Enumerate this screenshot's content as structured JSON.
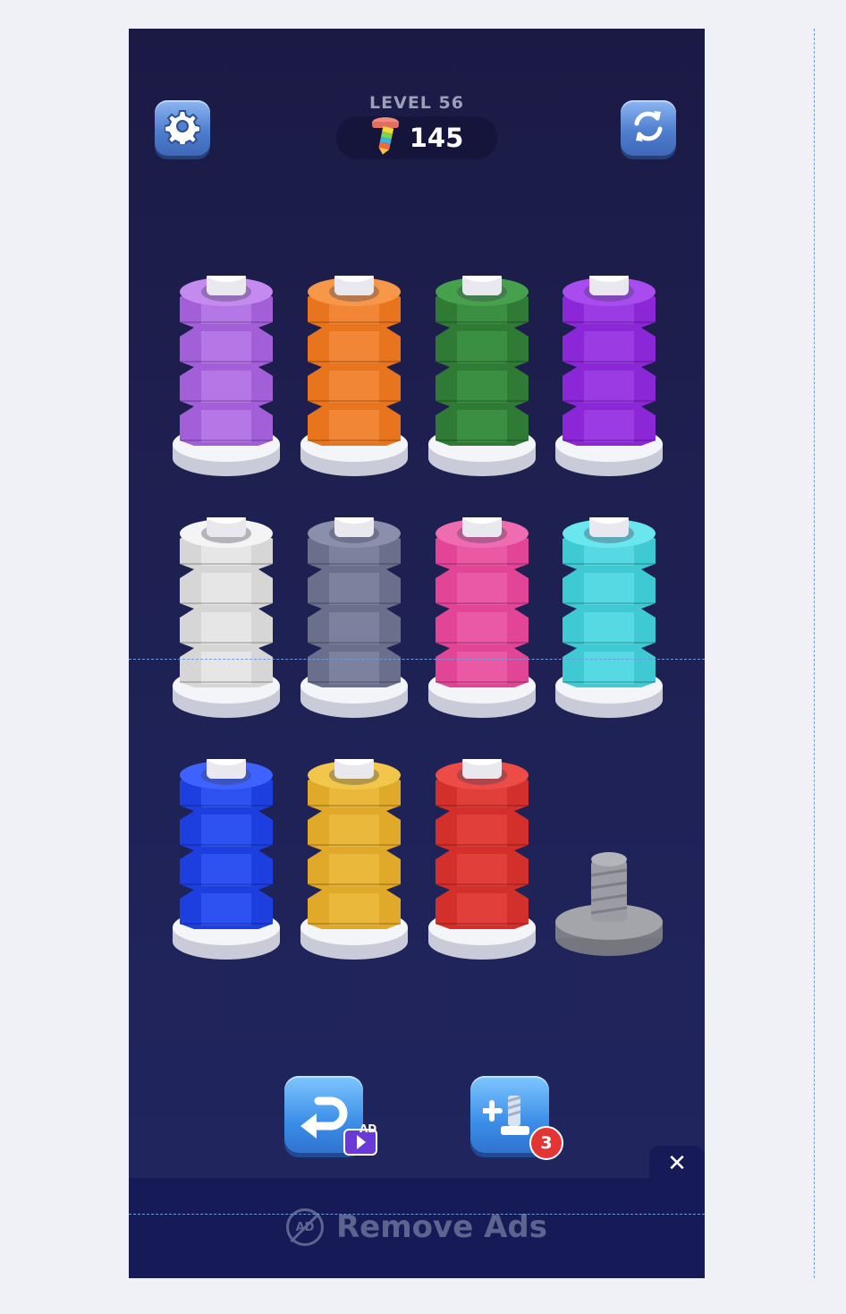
{
  "header": {
    "level_label": "LEVEL 56",
    "coin_count": "145"
  },
  "buttons": {
    "settings_icon": "gear-icon",
    "restart_icon": "refresh-icon",
    "undo_icon": "undo-arrow-icon",
    "undo_ad_label": "AD",
    "add_bolt_icon": "add-bolt-icon",
    "add_bolt_count": "3",
    "close_label": "✕"
  },
  "board": {
    "poles": [
      {
        "color": "#a25fd8",
        "light": "#c48af0",
        "nuts": 4
      },
      {
        "color": "#e8741e",
        "light": "#f7974a",
        "nuts": 4
      },
      {
        "color": "#2f7a35",
        "light": "#46a04c",
        "nuts": 4
      },
      {
        "color": "#8b27d6",
        "light": "#a84cf0",
        "nuts": 4
      },
      {
        "color": "#d6d6d6",
        "light": "#f4f4f4",
        "nuts": 4
      },
      {
        "color": "#6a6f8c",
        "light": "#8a8fab",
        "nuts": 4
      },
      {
        "color": "#e24596",
        "light": "#f06cb0",
        "nuts": 4
      },
      {
        "color": "#3fcad3",
        "light": "#6ae6ee",
        "nuts": 4
      },
      {
        "color": "#1d3fe0",
        "light": "#3d62ff",
        "nuts": 4
      },
      {
        "color": "#e0a92a",
        "light": "#f2c64a",
        "nuts": 4
      },
      {
        "color": "#d3302b",
        "light": "#ec4c45",
        "nuts": 4
      },
      {
        "color": "#8f8f96",
        "light": "#a9a9b0",
        "nuts": 0
      }
    ]
  },
  "ad_bar": {
    "remove_ads_label": "Remove Ads",
    "no_ad_icon_text": "AD"
  }
}
